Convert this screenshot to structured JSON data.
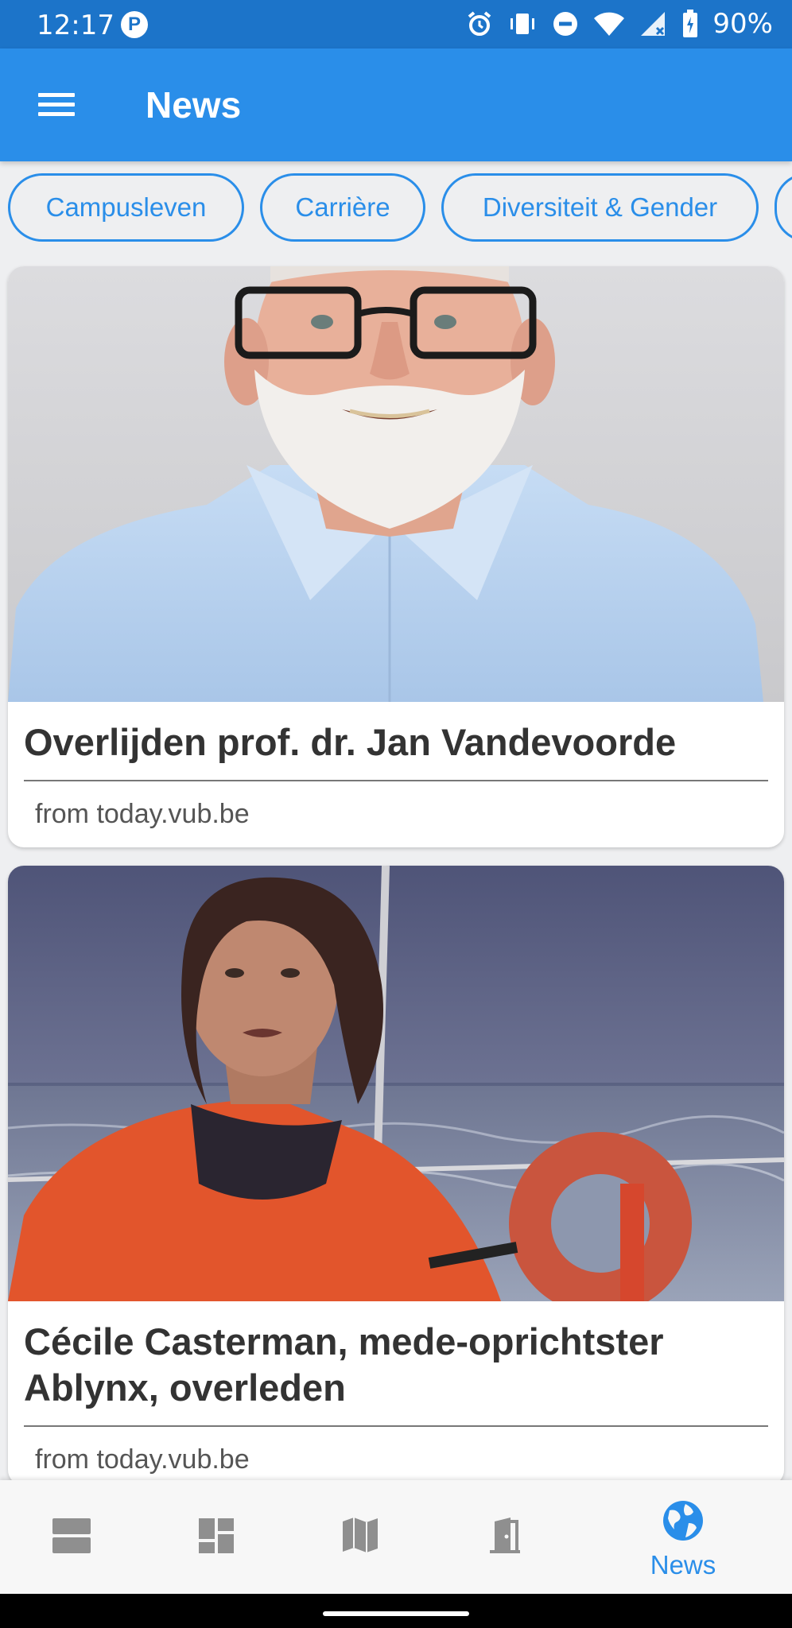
{
  "status_bar": {
    "time": "12:17",
    "battery": "90%"
  },
  "app_bar": {
    "title": "News"
  },
  "categories": [
    "Campusleven",
    "Carrière",
    "Diversiteit & Gender"
  ],
  "articles": [
    {
      "title": "Overlijden prof. dr. Jan Vandevoorde",
      "source": "from today.vub.be",
      "image": "portrait of bearded man in light blue shirt"
    },
    {
      "title": "Cécile Casterman, mede-oprichtster Ablynx, overleden",
      "source": "from today.vub.be",
      "image": "woman in orange jacket on a sailing boat at sea"
    }
  ],
  "bottom_nav": {
    "items": [
      {
        "icon": "view-agenda-icon"
      },
      {
        "icon": "dashboard-icon"
      },
      {
        "icon": "map-icon"
      },
      {
        "icon": "door-icon"
      },
      {
        "icon": "globe-icon",
        "label": "News",
        "active": true
      }
    ]
  },
  "colors": {
    "primary": "#2a8ee9",
    "status_bar": "#1c74c9",
    "inactive_icon": "#8f8f8f"
  }
}
